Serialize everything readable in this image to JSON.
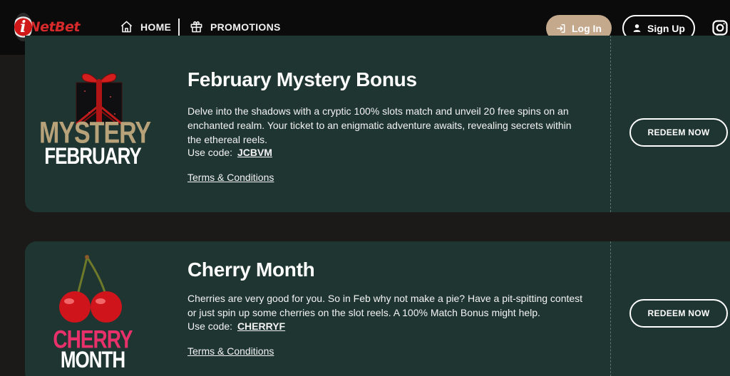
{
  "header": {
    "logo_text": "NetBet",
    "logo_letter": "i",
    "nav": [
      {
        "label": "HOME",
        "icon": "home-icon"
      },
      {
        "label": "PROMOTIONS",
        "icon": "gift-icon"
      }
    ],
    "login_label": "Log In",
    "signup_label": "Sign Up",
    "social_icon": "instagram-icon"
  },
  "promotions": [
    {
      "title": "February Mystery Bonus",
      "description": "Delve into the shadows with a cryptic 100% slots match and unveil 20 free spins on an enchanted realm. Your ticket to an enigmatic adventure awaits, revealing secrets within the ethereal reels.",
      "code_label": "Use code:",
      "code": "JCBVM",
      "terms_label": "Terms & Conditions",
      "redeem_label": "REDEEM NOW",
      "image_text_top": "MYSTERY",
      "image_text_bottom": "FEBRUARY"
    },
    {
      "title": "Cherry Month",
      "description": "Cherries are very good for you. So in Feb why not make a pie? Have a pit-spitting contest or just spin up some cherries on the slot reels. A 100% Match Bonus might help.",
      "code_label": "Use code:",
      "code": "CHERRYF",
      "terms_label": "Terms & Conditions",
      "redeem_label": "REDEEM NOW",
      "image_text_top": "CHERRY",
      "image_text_bottom": "MONTH"
    }
  ],
  "colors": {
    "page_bg": "#1c1a18",
    "header_bg": "#0b0b0b",
    "card_bg": "#1f3531",
    "login_bg": "#c4a98d",
    "brand_red": "#d82a2a",
    "mystery_gold": "#b8a27a",
    "cherry_pink": "#e8306a"
  }
}
